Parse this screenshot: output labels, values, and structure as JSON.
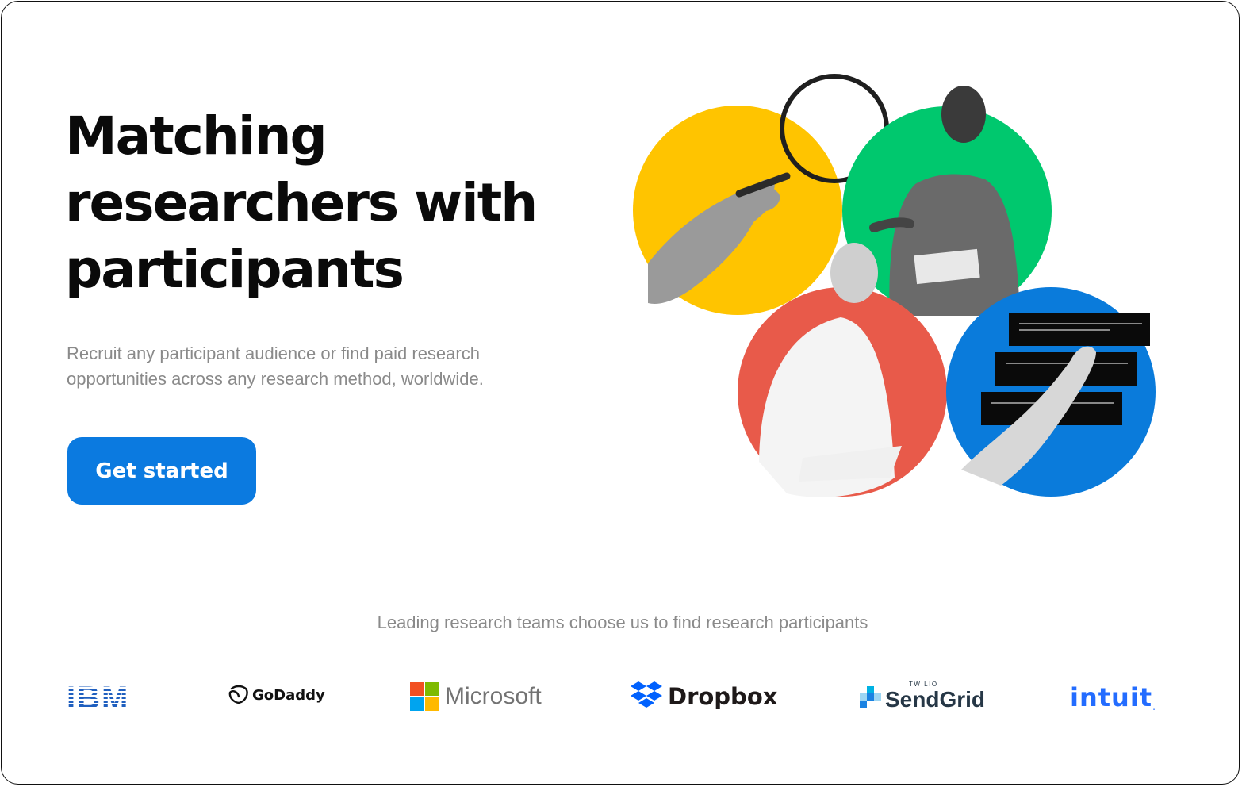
{
  "hero": {
    "title_lines": [
      "Matching",
      "researchers with",
      "participants"
    ],
    "subtitle_lines": [
      "Recruit any participant audience or find paid research",
      "opportunities across any research method, worldwide."
    ],
    "cta_label": "Get started"
  },
  "illustration": {
    "circle_colors": {
      "yellow": "#FFC400",
      "green": "#00C86E",
      "red": "#E85A4A",
      "blue": "#0A7BDB"
    }
  },
  "trust": {
    "caption": "Leading research teams choose us to find research participants",
    "logos": {
      "ibm": "IBM",
      "godaddy": "GoDaddy",
      "microsoft": "Microsoft",
      "dropbox": "Dropbox",
      "sendgrid_small": "TWILIO",
      "sendgrid": "SendGrid",
      "intuit": "intuit",
      "intuit_mark": "."
    }
  },
  "colors": {
    "accent": "#0B7AE0",
    "text": "#0A0A0A",
    "muted": "#8A8A8A"
  }
}
